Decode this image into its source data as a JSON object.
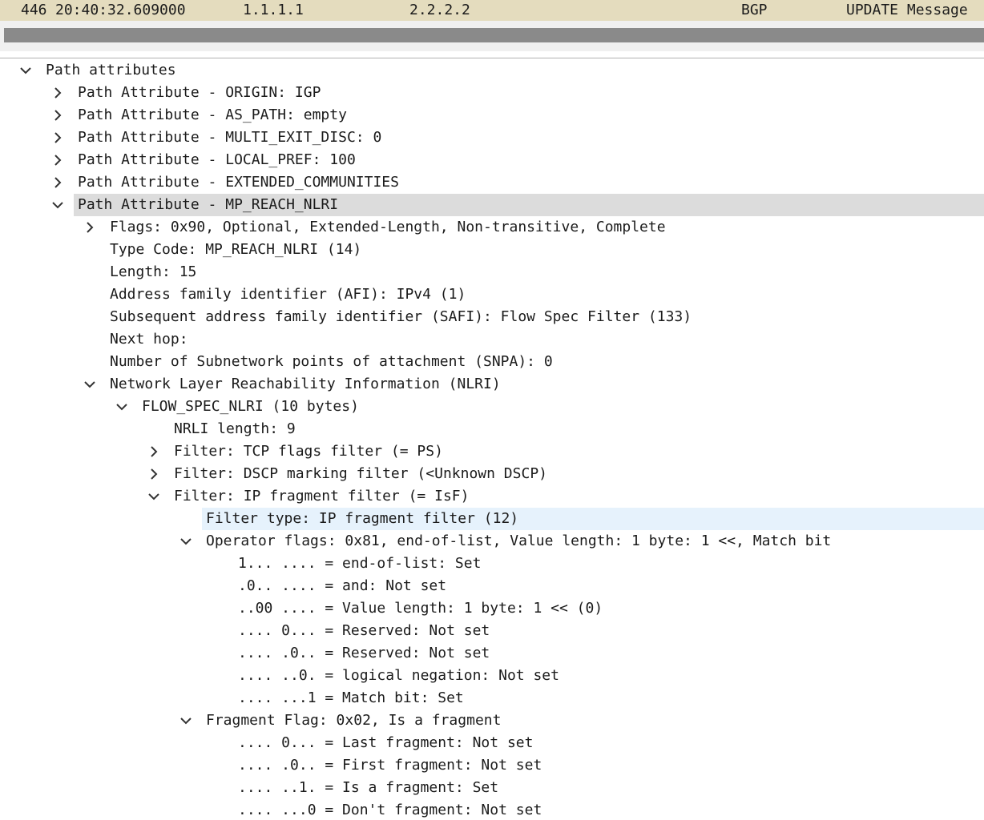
{
  "packet_list": {
    "row": {
      "number": "446",
      "time": "20:40:32.609000",
      "source": "1.1.1.1",
      "destination": "2.2.2.2",
      "protocol": "BGP",
      "info": "UPDATE Message"
    }
  },
  "tree": [
    {
      "text": "Path attributes",
      "level": 0,
      "toggle": "expanded"
    },
    {
      "text": "Path Attribute - ORIGIN: IGP",
      "level": 1,
      "toggle": "collapsed"
    },
    {
      "text": "Path Attribute - AS_PATH: empty",
      "level": 1,
      "toggle": "collapsed"
    },
    {
      "text": "Path Attribute - MULTI_EXIT_DISC: 0",
      "level": 1,
      "toggle": "collapsed"
    },
    {
      "text": "Path Attribute - LOCAL_PREF: 100",
      "level": 1,
      "toggle": "collapsed"
    },
    {
      "text": "Path Attribute - EXTENDED_COMMUNITIES",
      "level": 1,
      "toggle": "collapsed"
    },
    {
      "text": "Path Attribute - MP_REACH_NLRI",
      "level": 1,
      "toggle": "expanded",
      "state": "selected"
    },
    {
      "text": "Flags: 0x90, Optional, Extended-Length, Non-transitive, Complete",
      "level": 2,
      "toggle": "collapsed"
    },
    {
      "text": "Type Code: MP_REACH_NLRI (14)",
      "level": 2,
      "toggle": "none"
    },
    {
      "text": "Length: 15",
      "level": 2,
      "toggle": "none"
    },
    {
      "text": "Address family identifier (AFI): IPv4 (1)",
      "level": 2,
      "toggle": "none"
    },
    {
      "text": "Subsequent address family identifier (SAFI): Flow Spec Filter (133)",
      "level": 2,
      "toggle": "none"
    },
    {
      "text": "Next hop:",
      "level": 2,
      "toggle": "none"
    },
    {
      "text": "Number of Subnetwork points of attachment (SNPA): 0",
      "level": 2,
      "toggle": "none"
    },
    {
      "text": "Network Layer Reachability Information (NLRI)",
      "level": 2,
      "toggle": "expanded"
    },
    {
      "text": "FLOW_SPEC_NLRI (10 bytes)",
      "level": 3,
      "toggle": "expanded"
    },
    {
      "text": "NRLI length: 9",
      "level": 4,
      "toggle": "none"
    },
    {
      "text": "Filter: TCP flags filter (= PS)",
      "level": 4,
      "toggle": "collapsed"
    },
    {
      "text": "Filter: DSCP marking filter (<Unknown DSCP)",
      "level": 4,
      "toggle": "collapsed"
    },
    {
      "text": "Filter: IP fragment filter (= IsF)",
      "level": 4,
      "toggle": "expanded"
    },
    {
      "text": "Filter type: IP fragment filter (12)",
      "level": 5,
      "toggle": "none",
      "state": "focused"
    },
    {
      "text": "Operator flags: 0x81, end-of-list, Value length: 1 byte: 1 <<, Match bit",
      "level": 5,
      "toggle": "expanded"
    },
    {
      "text": "1... .... = end-of-list: Set",
      "level": 6,
      "toggle": "none"
    },
    {
      "text": ".0.. .... = and: Not set",
      "level": 6,
      "toggle": "none"
    },
    {
      "text": "..00 .... = Value length: 1 byte: 1 << (0)",
      "level": 6,
      "toggle": "none"
    },
    {
      "text": ".... 0... = Reserved: Not set",
      "level": 6,
      "toggle": "none"
    },
    {
      "text": ".... .0.. = Reserved: Not set",
      "level": 6,
      "toggle": "none"
    },
    {
      "text": ".... ..0. = logical negation: Not set",
      "level": 6,
      "toggle": "none"
    },
    {
      "text": ".... ...1 = Match bit: Set",
      "level": 6,
      "toggle": "none"
    },
    {
      "text": "Fragment Flag: 0x02, Is a fragment",
      "level": 5,
      "toggle": "expanded"
    },
    {
      "text": ".... 0... = Last fragment: Not set",
      "level": 6,
      "toggle": "none"
    },
    {
      "text": ".... .0.. = First fragment: Not set",
      "level": 6,
      "toggle": "none"
    },
    {
      "text": ".... ..1. = Is a fragment: Set",
      "level": 6,
      "toggle": "none"
    },
    {
      "text": ".... ...0 = Don't fragment: Not set",
      "level": 6,
      "toggle": "none"
    }
  ]
}
